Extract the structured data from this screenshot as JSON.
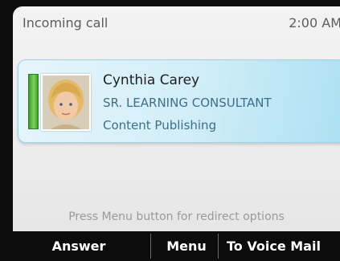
{
  "status_bar": {
    "title": "Incoming call",
    "time": "2:00 AM"
  },
  "caller": {
    "name": "Cynthia Carey",
    "title": "SR. LEARNING CONSULTANT",
    "department": "Content Publishing",
    "presence_color": "#5cc043"
  },
  "hint": "Press Menu button for redirect options",
  "softkeys": {
    "answer": "Answer",
    "menu": "Menu",
    "voicemail": "To Voice Mail"
  }
}
